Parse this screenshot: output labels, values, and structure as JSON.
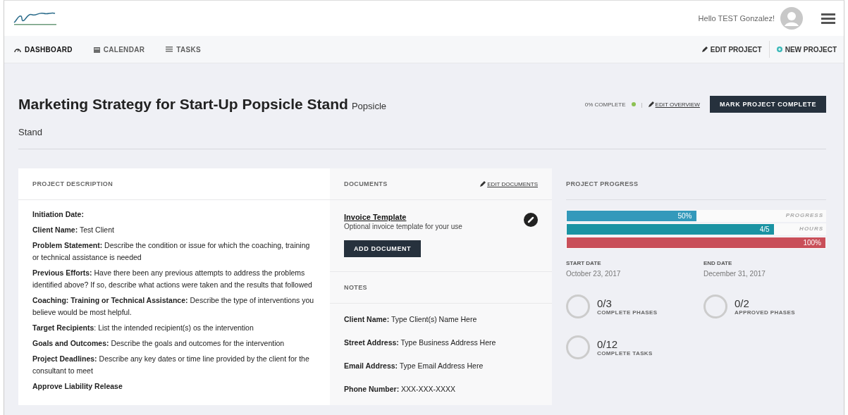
{
  "header": {
    "greeting": "Hello TEST Gonzalez!"
  },
  "nav_tabs": [
    {
      "label": "DASHBOARD",
      "selected": true
    },
    {
      "label": "CALENDAR",
      "selected": false
    },
    {
      "label": "TASKS",
      "selected": false
    }
  ],
  "nav_actions": [
    "EDIT PROJECT",
    "NEW PROJECT"
  ],
  "project": {
    "title": "Marketing Strategy for Start-Up Popsicle Stand",
    "subtitle": "Popsicle Stand",
    "completion": "0% COMPLETE",
    "separator": "|",
    "edit_link": "EDIT OVERVIEW",
    "complete_button": "MARK PROJECT COMPLETE"
  },
  "description": {
    "heading": "PROJECT DESCRIPTION",
    "items": [
      "**Initiation Date:**",
      "**Client Name:** Test Client",
      "**Problem Statement:** Describe the condition or issue for which the coaching, training or technical assistance is needed",
      "**Previous Efforts:** Have there been any previous attempts to address the problems identified above? If so, describe what actions were taken and the results that followed",
      "**Coaching: Training or Technical Assistance:** Describe the type of interventions you believe would be most helpful.",
      "**Target Recipients**: List the intended recipient(s) os the intervention",
      "**Goals and Outcomes:** Describe the goals and outcomes for the intervention",
      "**Project Deadlines:** Describe any key dates or time line provided by the client for the consultant to meet",
      "**Approve Liability Release**"
    ]
  },
  "documents": {
    "heading": "DOCUMENTS",
    "edit_link": "EDIT DOCUMENTS",
    "items": [
      {
        "title": "Invoice Template",
        "description": "Optional invoice template for your use"
      }
    ],
    "add_button": "ADD DOCUMENT"
  },
  "notes": {
    "heading": "NOTES",
    "items": [
      "**Client Name:** Type Client(s) Name Here",
      "**Street Address:** Type Business Address Here",
      "**Email Address:** Type Email Address Here",
      "**Phone Number:** XXX-XXX-XXXX"
    ]
  },
  "progress": {
    "heading": "PROJECT PROGRESS",
    "bars": [
      {
        "value": "50%",
        "label": "PROGRESS",
        "level": 0.5,
        "color": "#3399bb"
      },
      {
        "value": "4/5",
        "label": "HOURS",
        "level": 0.8,
        "color": "#1a93a3"
      },
      {
        "value": "100%",
        "level": 1.0,
        "color": "#c94f59"
      }
    ],
    "dates": [
      {
        "label": "START DATE",
        "value": "October 23, 2017"
      },
      {
        "label": "END DATE",
        "value": "December 31, 2017"
      }
    ],
    "stats": [
      {
        "count": "0/3",
        "label": "COMPLETE PHASES"
      },
      {
        "count": "0/2",
        "label": "APPROVED PHASES"
      },
      {
        "count": "0/12",
        "label": "COMPLETE TASKS"
      }
    ]
  }
}
